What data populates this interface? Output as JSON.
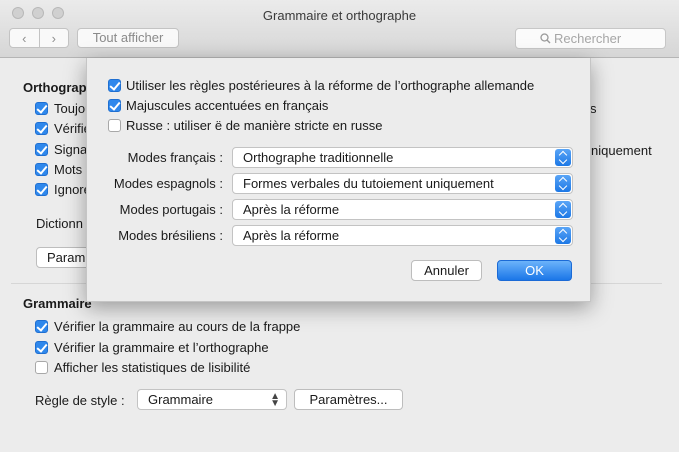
{
  "window": {
    "title": "Grammaire et orthographe"
  },
  "toolbar": {
    "show_all_label": "Tout afficher",
    "search_placeholder": "Rechercher"
  },
  "background": {
    "ortho_section_title": "Orthograp",
    "ortho_items": [
      {
        "label": "Toujou",
        "checked": true
      },
      {
        "label": "Vérifie",
        "checked": true
      },
      {
        "label": "Signa",
        "checked": true
      },
      {
        "label": "Mots",
        "checked": true
      },
      {
        "label": "Ignore",
        "checked": true
      }
    ],
    "ortho_right_partial_1": "s",
    "ortho_right_partial_2": "niquement",
    "dictionary_label": "Dictionn",
    "params_partial_label": "Param",
    "grammar_section_title": "Grammaire",
    "grammar_items": [
      {
        "label": "Vérifier la grammaire au cours de la frappe",
        "checked": true
      },
      {
        "label": "Vérifier la grammaire et l’orthographe",
        "checked": true
      },
      {
        "label": "Afficher les statistiques de lisibilité",
        "checked": false
      }
    ],
    "style_rule_label": "Règle de style :",
    "style_rule_value": "Grammaire",
    "params_button_label": "Paramètres..."
  },
  "sheet": {
    "options": [
      {
        "label": "Utiliser les règles postérieures à la réforme de l’orthographe allemande",
        "checked": true
      },
      {
        "label": "Majuscules accentuées en français",
        "checked": true
      },
      {
        "label": "Russe : utiliser ë de manière stricte en russe",
        "checked": false
      }
    ],
    "modes": [
      {
        "label": "Modes français :",
        "value": "Orthographe traditionnelle"
      },
      {
        "label": "Modes espagnols :",
        "value": "Formes verbales du tutoiement uniquement"
      },
      {
        "label": "Modes portugais :",
        "value": "Après la réforme"
      },
      {
        "label": "Modes brésiliens :",
        "value": "Après la réforme"
      }
    ],
    "cancel_label": "Annuler",
    "ok_label": "OK"
  }
}
